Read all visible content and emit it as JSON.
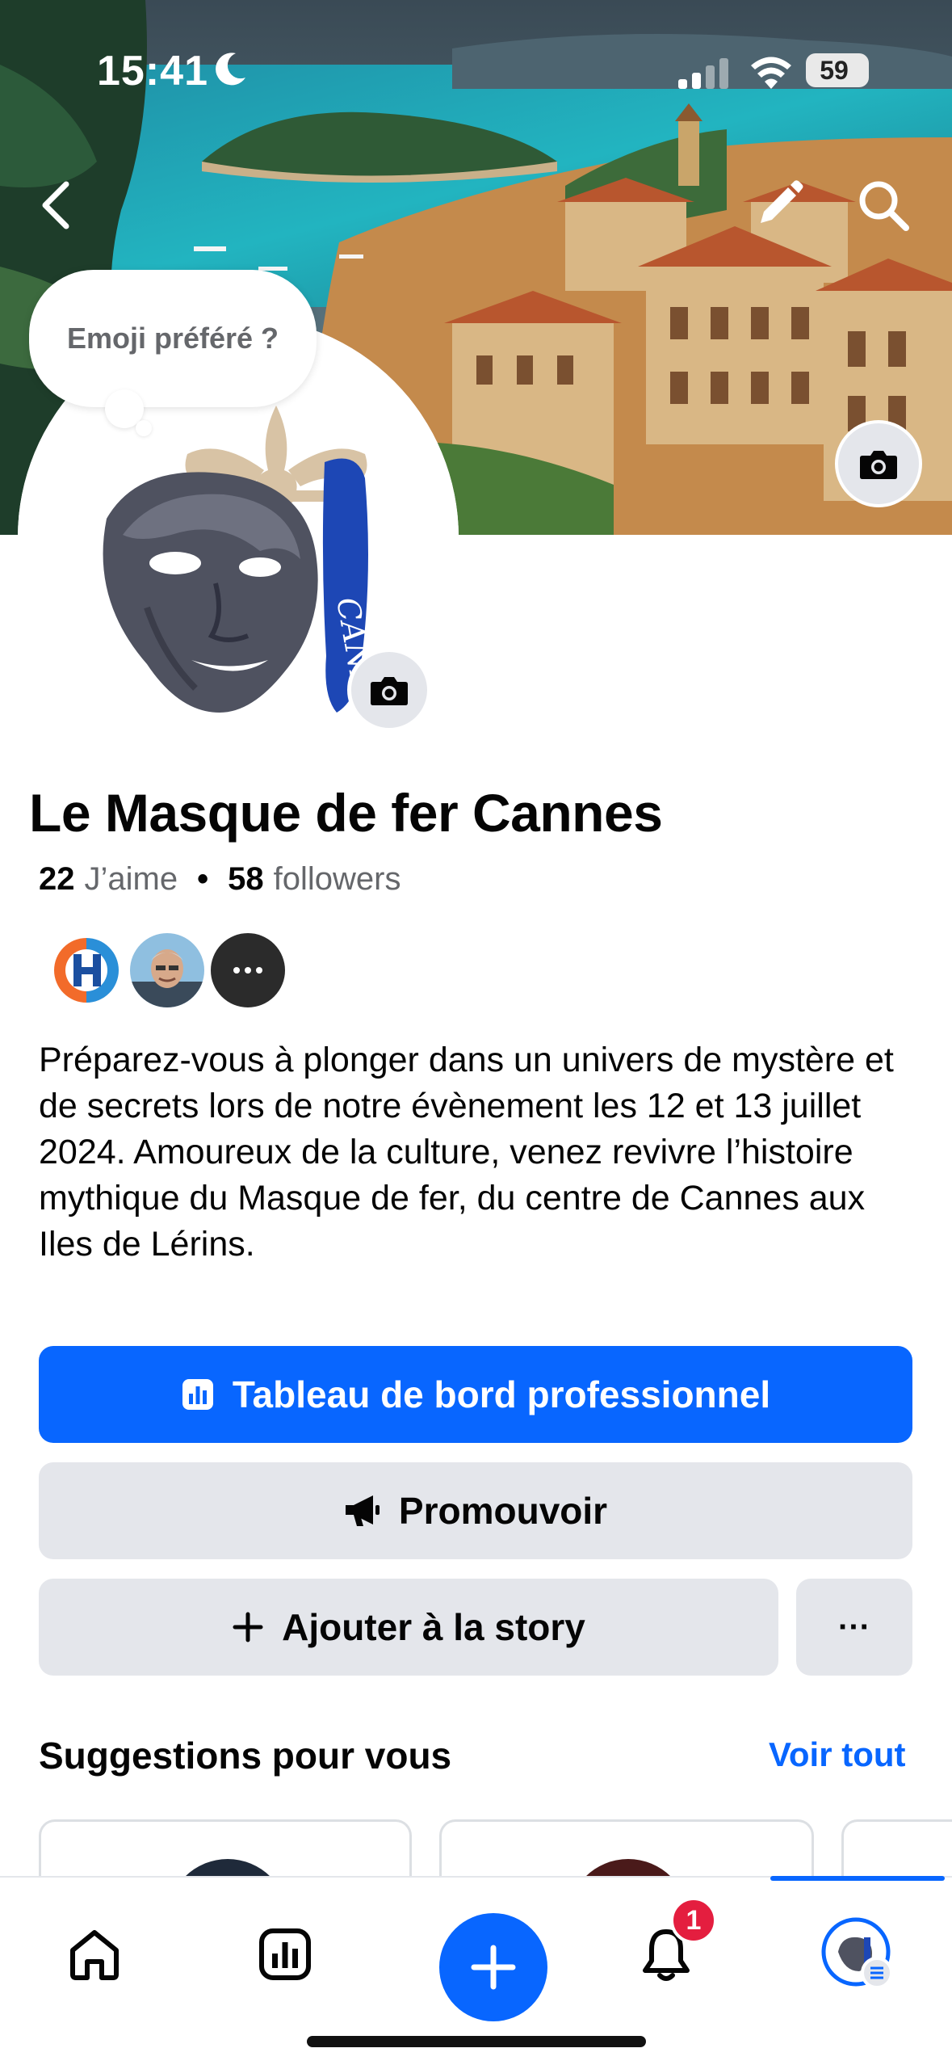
{
  "status_bar": {
    "time": "15:41",
    "battery": "59"
  },
  "cover": {
    "edit_icon": "pencil-icon",
    "search_icon": "search-icon",
    "camera_icon": "camera-icon"
  },
  "bubble": {
    "text": "Emoji préféré ?"
  },
  "page": {
    "name": "Le Masque de fer Cannes",
    "likes_count": "22",
    "likes_label": "J’aime",
    "followers_count": "58",
    "followers_label": "followers",
    "bio": "Préparez-vous à plonger dans un univers de mystère et de secrets lors de notre évènement les 12 et 13 juillet 2024. Amoureux de la culture, venez revivre l’histoire mythique du Masque de fer, du centre de Cannes aux Iles de Lérins."
  },
  "actions": {
    "dashboard": "Tableau de bord professionnel",
    "promote": "Promouvoir",
    "add_story": "Ajouter à la story",
    "more": "···"
  },
  "suggestions": {
    "title": "Suggestions pour vous",
    "see_all": "Voir tout"
  },
  "tabbar": {
    "notification_badge": "1"
  },
  "colors": {
    "accent": "#0866ff",
    "button_grey": "#e4e6eb",
    "badge_red": "#e41e3f",
    "secondary_text": "#65676b"
  }
}
